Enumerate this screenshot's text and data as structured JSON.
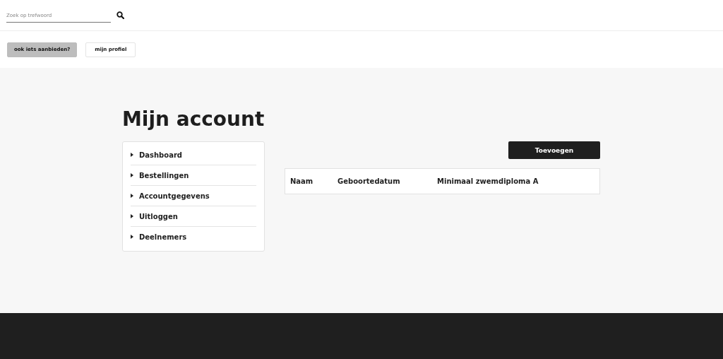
{
  "search": {
    "placeholder": "Zoek op trefwoord"
  },
  "header_buttons": [
    {
      "label": "ook iets aanbieden?",
      "kind": "filled"
    },
    {
      "label": "mijn profiel",
      "kind": "outline"
    }
  ],
  "page_title": "Mijn account",
  "sidebar": {
    "items": [
      {
        "label": "Dashboard"
      },
      {
        "label": "Bestellingen"
      },
      {
        "label": "Accountgegevens"
      },
      {
        "label": "Uitloggen"
      },
      {
        "label": "Deelnemers"
      }
    ]
  },
  "add_button": "Toevoegen",
  "table": {
    "columns": [
      "Naam",
      "Geboortedatum",
      "Minimaal zwemdiploma A"
    ]
  }
}
